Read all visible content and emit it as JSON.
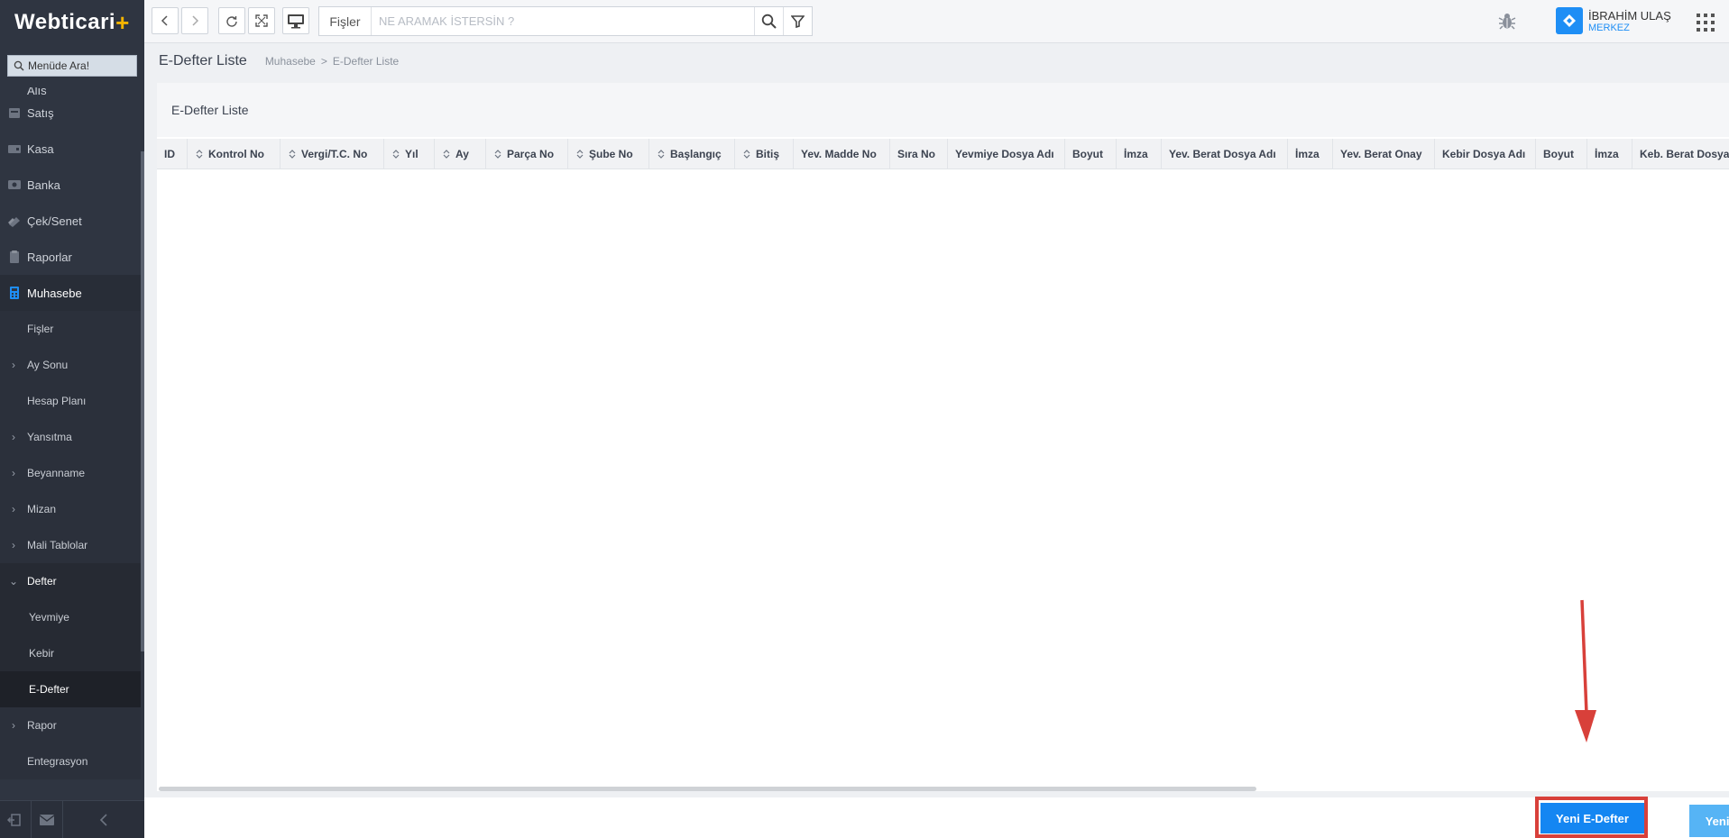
{
  "app": {
    "logo_text": "Webticari",
    "logo_plus": "+"
  },
  "sidebar": {
    "search_placeholder": "Menüde Ara!",
    "partial_top_item": "Alış",
    "items": [
      {
        "label": "Satış",
        "icon": "cart-icon"
      },
      {
        "label": "Kasa",
        "icon": "cash-register-icon"
      },
      {
        "label": "Banka",
        "icon": "bank-icon"
      },
      {
        "label": "Çek/Senet",
        "icon": "check-note-icon"
      },
      {
        "label": "Raporlar",
        "icon": "clipboard-icon"
      },
      {
        "label": "Muhasebe",
        "icon": "calculator-icon"
      }
    ],
    "submenu": [
      {
        "label": "Fişler"
      },
      {
        "label": "Ay Sonu"
      },
      {
        "label": "Hesap Planı"
      },
      {
        "label": "Yansıtma"
      },
      {
        "label": "Beyanname"
      },
      {
        "label": "Mizan"
      },
      {
        "label": "Mali Tablolar"
      },
      {
        "label": "Defter"
      },
      {
        "label": "Yevmiye"
      },
      {
        "label": "Kebir"
      },
      {
        "label": "E-Defter"
      },
      {
        "label": "Rapor"
      },
      {
        "label": "Entegrasyon"
      }
    ]
  },
  "topbar": {
    "search_category": "Fişler",
    "search_placeholder": "NE ARAMAK İSTERSİN ?",
    "user_name": "İBRAHİM ULAŞ",
    "user_branch": "MERKEZ"
  },
  "breadcrumb": {
    "page_title": "E-Defter Liste",
    "parent": "Muhasebe",
    "separator": ">",
    "current": "E-Defter Liste"
  },
  "panel": {
    "title": "E-Defter Liste",
    "columns": [
      {
        "label": "ID",
        "sortable": false
      },
      {
        "label": "Kontrol No",
        "sortable": true
      },
      {
        "label": "Vergi/T.C. No",
        "sortable": true
      },
      {
        "label": "Yıl",
        "sortable": true
      },
      {
        "label": "Ay",
        "sortable": true
      },
      {
        "label": "Parça No",
        "sortable": true
      },
      {
        "label": "Şube No",
        "sortable": true
      },
      {
        "label": "Başlangıç",
        "sortable": true
      },
      {
        "label": "Bitiş",
        "sortable": true
      },
      {
        "label": "Yev. Madde No",
        "sortable": false
      },
      {
        "label": "Sıra No",
        "sortable": false
      },
      {
        "label": "Yevmiye Dosya Adı",
        "sortable": false
      },
      {
        "label": "Boyut",
        "sortable": false
      },
      {
        "label": "İmza",
        "sortable": false
      },
      {
        "label": "Yev. Berat Dosya Adı",
        "sortable": false
      },
      {
        "label": "İmza",
        "sortable": false
      },
      {
        "label": "Yev. Berat Onay",
        "sortable": false
      },
      {
        "label": "Kebir Dosya Adı",
        "sortable": false
      },
      {
        "label": "Boyut",
        "sortable": false
      },
      {
        "label": "İmza",
        "sortable": false
      },
      {
        "label": "Keb. Berat Dosya Adı",
        "sortable": false
      }
    ],
    "rows": []
  },
  "actions": {
    "new_label": "Yeni E-Defter",
    "refresh_label": "Yenile"
  },
  "colors": {
    "accent": "#1486f2",
    "sidebar_bg": "#2f3541",
    "highlight": "#d8403a",
    "refresh": "#56b4f5"
  }
}
